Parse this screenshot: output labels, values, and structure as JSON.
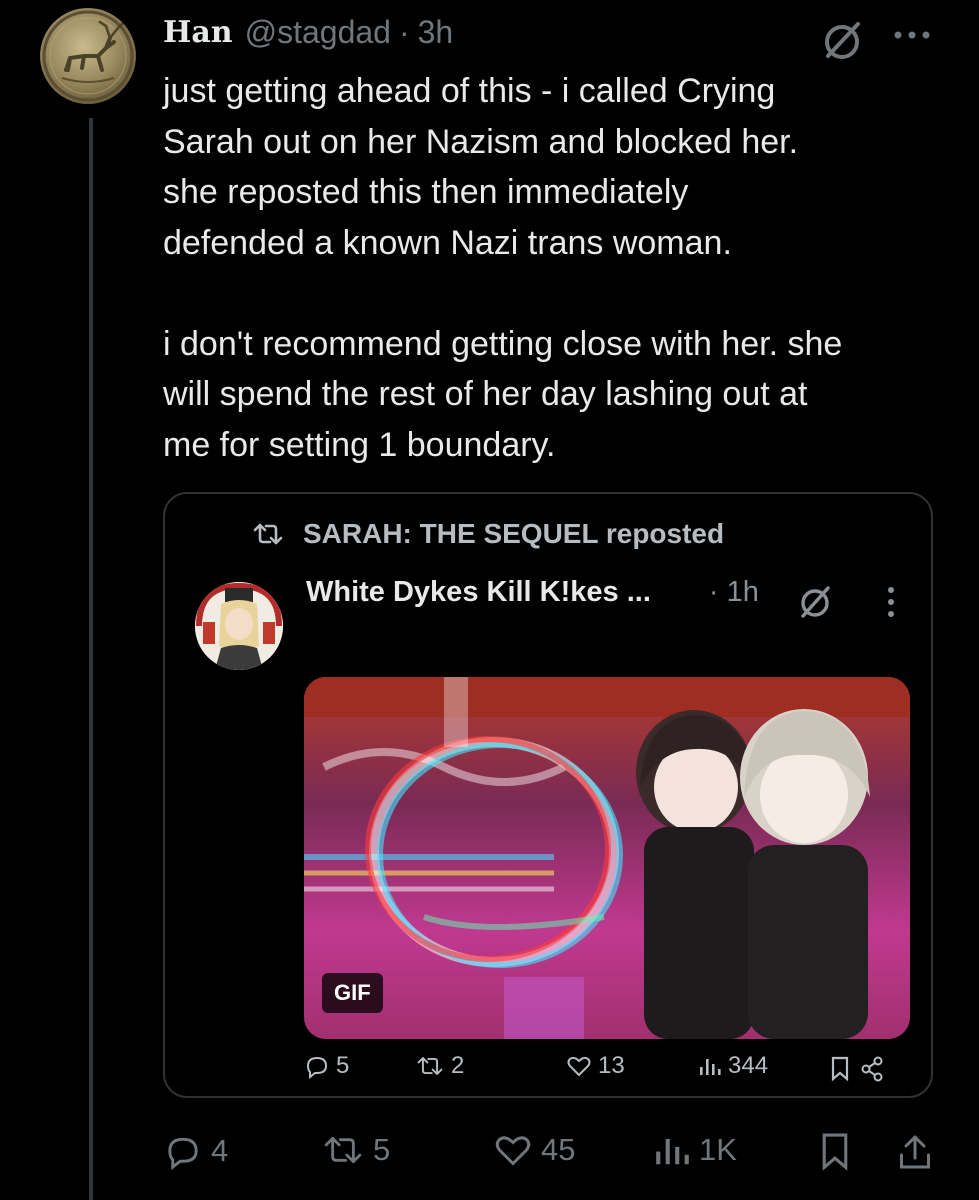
{
  "post": {
    "display_name": "Han",
    "handle": "@stagdad",
    "separator": "·",
    "time": "3h",
    "text": "just getting ahead of this - i called Crying\nSarah out on her Nazism and blocked her.\nshe reposted this then immediately\ndefended a known Nazi trans woman.\n\ni don't recommend getting close with her. she\nwill spend the rest of her day lashing out at\nme for setting 1 boundary.",
    "actions": {
      "replies": "4",
      "reposts": "5",
      "likes": "45",
      "views": "1K"
    }
  },
  "quote": {
    "repost_label": "SARAH: THE SEQUEL reposted",
    "display_name": "White Dykes Kill K!kes ...",
    "time": "· 1h",
    "media_badge": "GIF",
    "actions": {
      "replies": "5",
      "reposts": "2",
      "likes": "13",
      "views": "344"
    }
  },
  "colors": {
    "background": "#000000",
    "text": "#e7e9ea",
    "muted": "#71767b",
    "border": "#2f3336"
  }
}
